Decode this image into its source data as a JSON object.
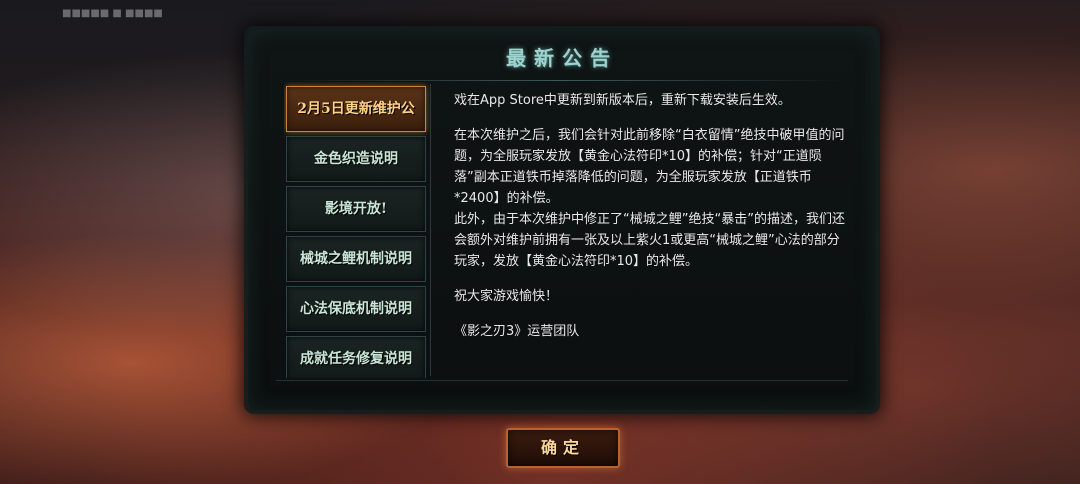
{
  "status_bar": {
    "text": "■■■■■  ■ ■■■■"
  },
  "dialog": {
    "title": "最新公告",
    "confirm_label": "确定"
  },
  "tabs": [
    {
      "label": "2月5日更新维护公",
      "active": true
    },
    {
      "label": "金色织造说明",
      "active": false
    },
    {
      "label": "影境开放!",
      "active": false
    },
    {
      "label": "械城之鲤机制说明",
      "active": false
    },
    {
      "label": "心法保底机制说明",
      "active": false
    },
    {
      "label": "成就任务修复说明",
      "active": false
    }
  ],
  "announcement": {
    "paragraphs": [
      "戏在App Store中更新到新版本后，重新下载安装后生效。",
      "在本次维护之后，我们会针对此前移除“白衣留情”绝技中破甲值的问题，为全服玩家发放【黄金心法符印*10】的补偿；针对“正道陨落”副本正道铁币掉落降低的问题，为全服玩家发放【正道铁币*2400】的补偿。\n此外，由于本次维护中修正了“械城之鲤”绝技“暴击”的描述，我们还会额外对维护前拥有一张及以上紫火1或更高“械城之鲤”心法的部分玩家，发放【黄金心法符印*10】的补偿。",
      "祝大家游戏愉快！",
      "《影之刃3》运营团队"
    ]
  },
  "colors": {
    "title": "#9ed3cf",
    "tab_active_border": "#c9873e",
    "tab_active_text": "#ffd08a",
    "tab_text": "#c9e6d6",
    "confirm_border": "#b8622c"
  }
}
